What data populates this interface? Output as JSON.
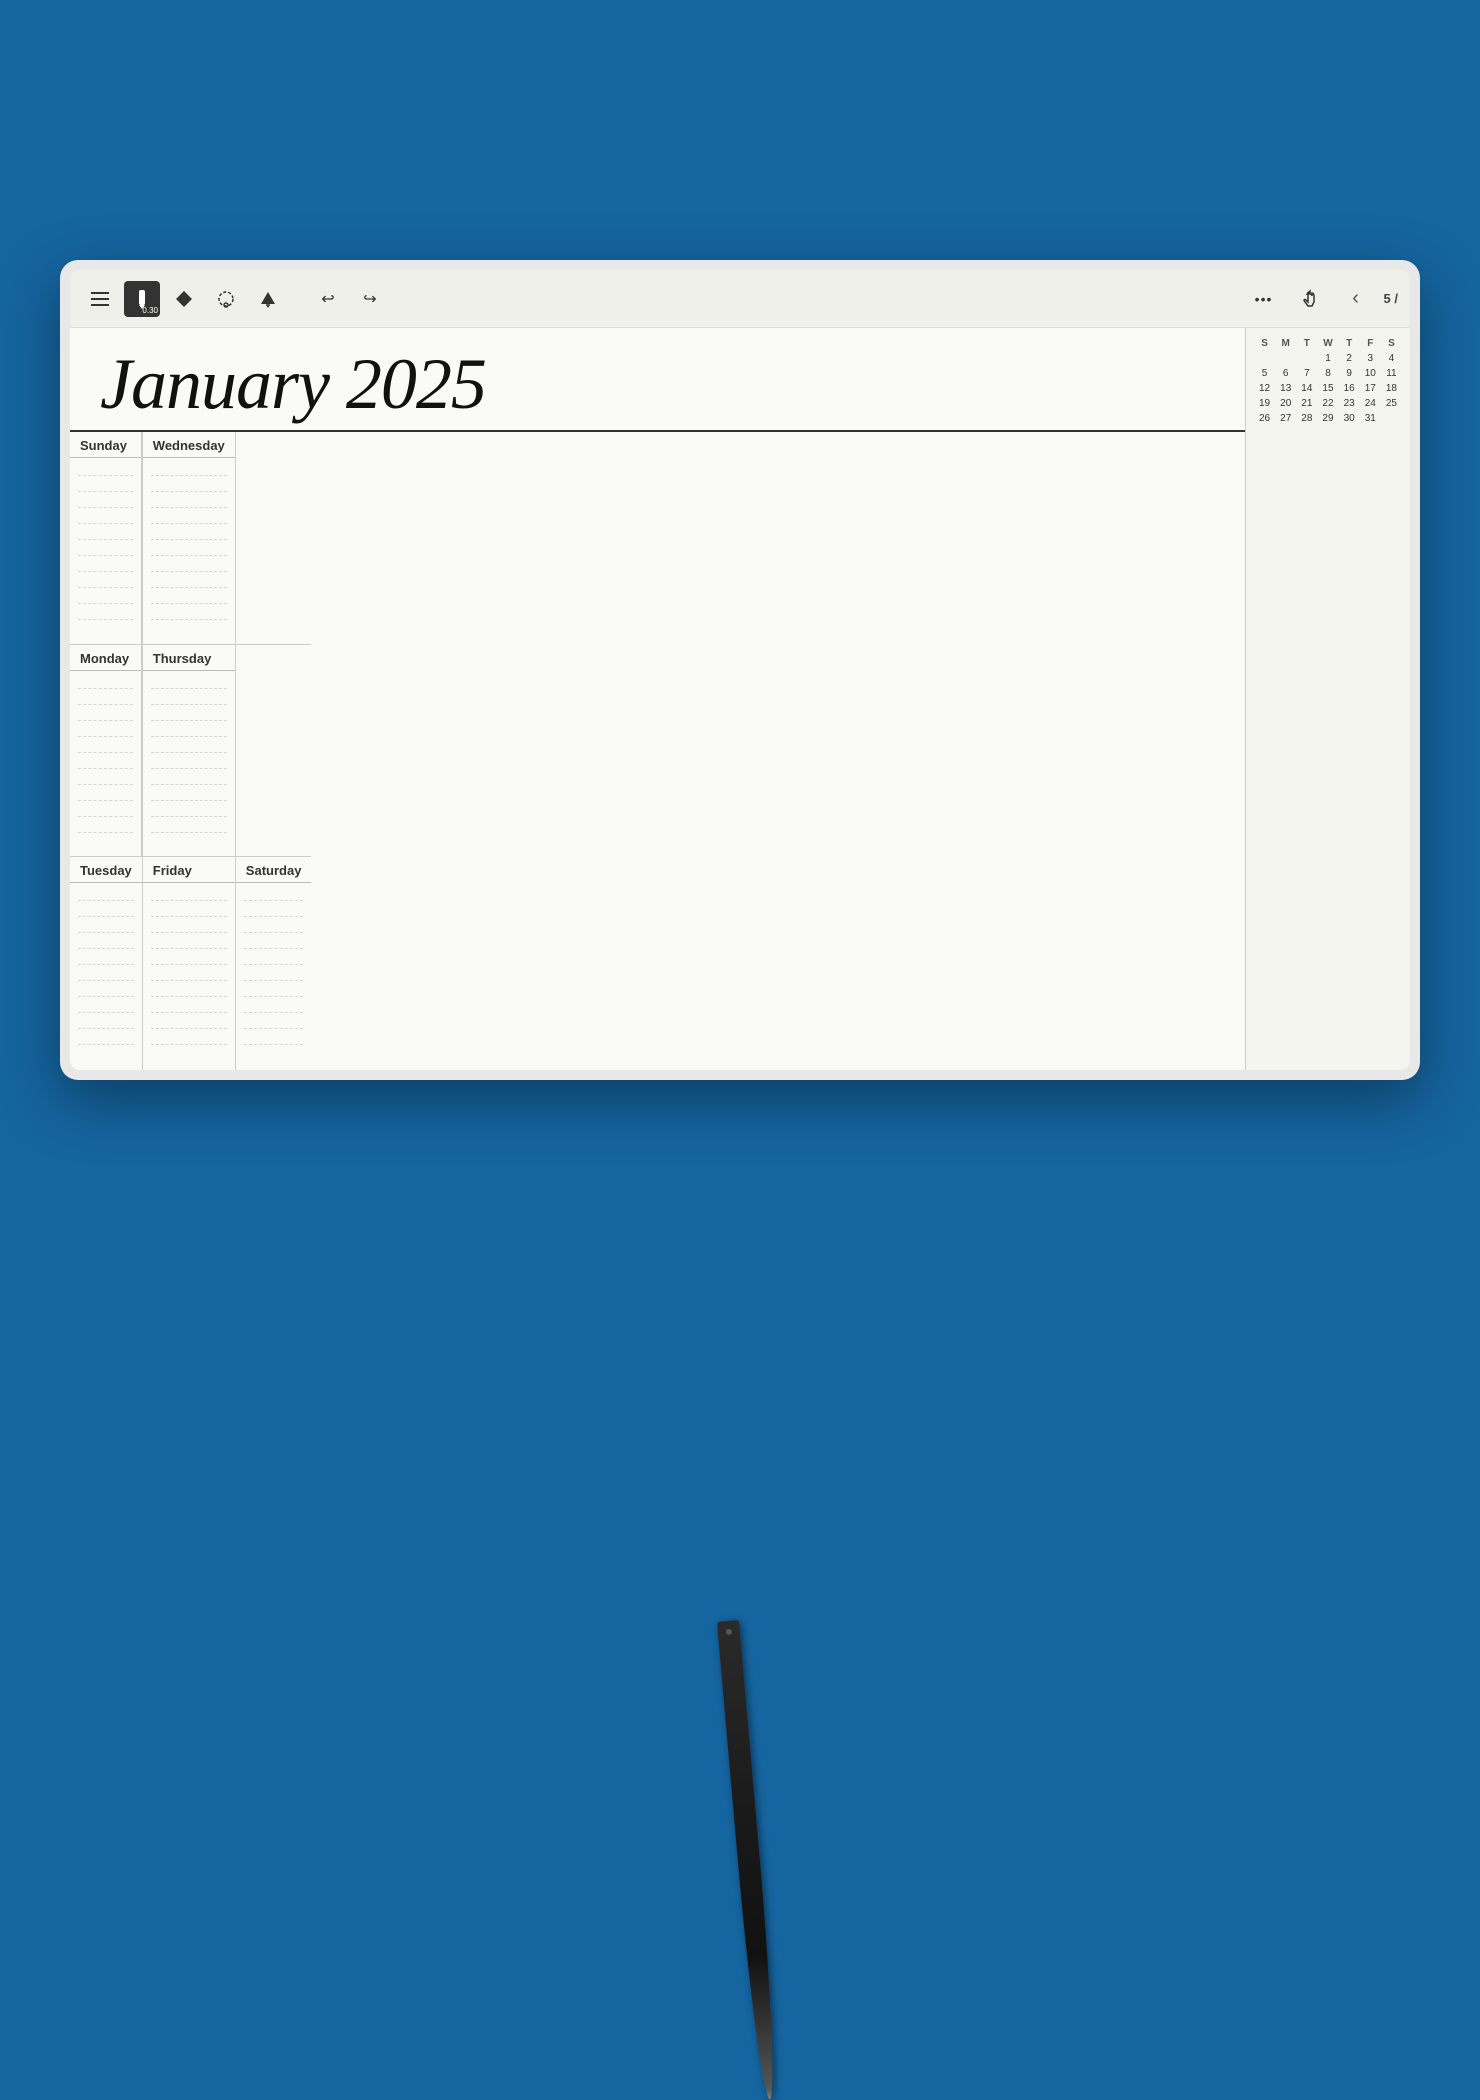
{
  "background_color": "#1565a0",
  "tablet": {
    "toolbar": {
      "tools": [
        {
          "name": "menu",
          "icon": "☰",
          "active": false
        },
        {
          "name": "pen",
          "icon": "✏",
          "active": true,
          "label": "0.30"
        },
        {
          "name": "highlighter",
          "icon": "◆",
          "active": false
        },
        {
          "name": "lasso",
          "icon": "⬡",
          "active": false
        },
        {
          "name": "eraser",
          "icon": "▲",
          "active": false
        },
        {
          "name": "undo",
          "icon": "↩",
          "active": false
        },
        {
          "name": "redo",
          "icon": "↪",
          "active": false
        }
      ],
      "right_tools": [
        {
          "name": "more",
          "icon": "•••"
        },
        {
          "name": "touch",
          "icon": "☞"
        },
        {
          "name": "back",
          "icon": "‹"
        },
        {
          "name": "page",
          "label": "5 /"
        }
      ]
    },
    "planner": {
      "month_title": "January 2025",
      "days": [
        {
          "name": "Sunday",
          "key": "sunday"
        },
        {
          "name": "Monday",
          "key": "monday"
        },
        {
          "name": "Tuesday",
          "key": "tuesday"
        },
        {
          "name": "Wednesday",
          "key": "wednesday"
        },
        {
          "name": "Thursday",
          "key": "thursday"
        },
        {
          "name": "Friday",
          "key": "friday"
        },
        {
          "name": "Saturday",
          "key": "saturday"
        }
      ],
      "lines_per_day": 10
    },
    "mini_calendar": {
      "headers": [
        "S",
        "M",
        "T",
        "W",
        "T",
        "F",
        "S"
      ],
      "rows": [
        [
          "",
          "",
          "",
          "1",
          "2",
          "3",
          "4"
        ],
        [
          "5",
          "6",
          "7",
          "8",
          "9",
          "10",
          "11"
        ],
        [
          "12",
          "13",
          "14",
          "15",
          "16",
          "17",
          "18"
        ],
        [
          "19",
          "20",
          "21",
          "22",
          "23",
          "24",
          "25"
        ],
        [
          "26",
          "27",
          "28",
          "29",
          "30",
          "31",
          ""
        ]
      ]
    }
  }
}
